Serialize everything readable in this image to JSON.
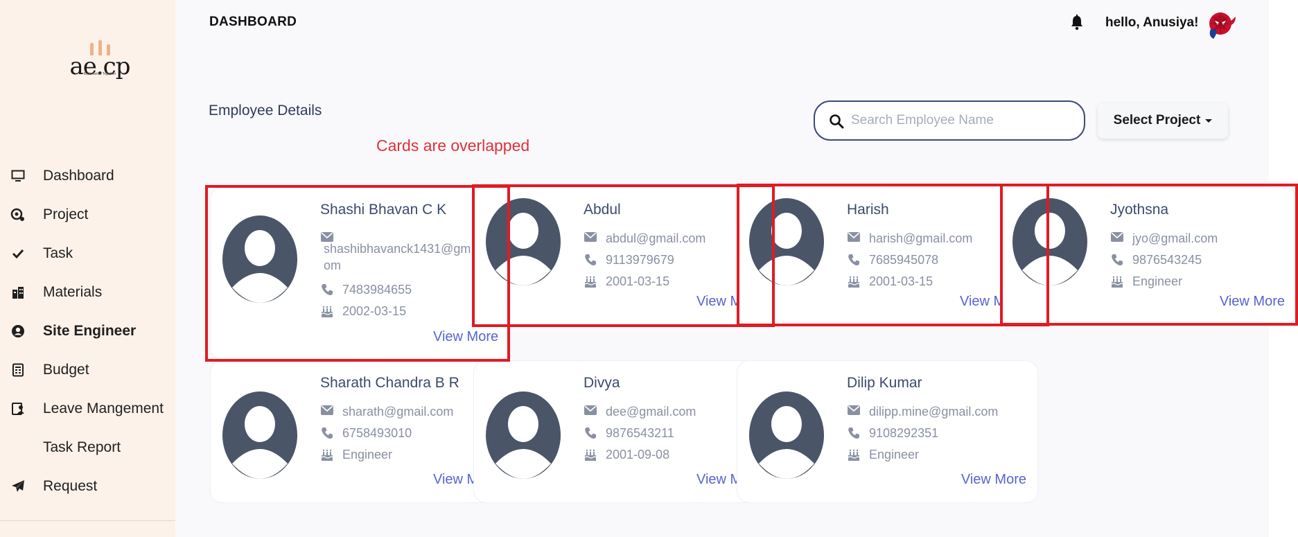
{
  "app": {
    "logo_text": "ae.cp",
    "logo_tagline": "Build Better Together"
  },
  "topbar": {
    "title": "DASHBOARD",
    "greeting": "hello, Anusiya!"
  },
  "sidebar": {
    "items": [
      {
        "label": "Dashboard",
        "icon": "monitor-icon"
      },
      {
        "label": "Project",
        "icon": "project-icon"
      },
      {
        "label": "Task",
        "icon": "check-icon"
      },
      {
        "label": "Materials",
        "icon": "building-icon"
      },
      {
        "label": "Site Engineer",
        "icon": "user-circle-icon",
        "active": true
      },
      {
        "label": "Budget",
        "icon": "budget-icon"
      },
      {
        "label": "Leave Mangement",
        "icon": "leave-icon"
      },
      {
        "label": "Task Report",
        "icon": ""
      },
      {
        "label": "Request",
        "icon": "paper-plane-icon"
      }
    ]
  },
  "main": {
    "section_title": "Employee Details",
    "annotation": "Cards are overlapped",
    "search": {
      "placeholder": "Search Employee Name",
      "value": ""
    },
    "select_project_label": "Select Project",
    "view_more_label": "View More"
  },
  "employees": [
    {
      "name": "Shashi Bhavan C K",
      "email_line1": "shashibhavanck1431@gm",
      "email_line2": "om",
      "phone": "7483984655",
      "detail": "2002-03-15",
      "view_more": "View More"
    },
    {
      "name": "Abdul",
      "email": "abdul@gmail.com",
      "phone": "9113979679",
      "detail": "2001-03-15",
      "view_more": "View M"
    },
    {
      "name": "Harish",
      "email": "harish@gmail.com",
      "phone": "7685945078",
      "detail": "2001-03-15",
      "view_more": "View M"
    },
    {
      "name": "Jyothsna",
      "email": "jyo@gmail.com",
      "phone": "9876543245",
      "detail": "Engineer",
      "view_more": "View More"
    },
    {
      "name": "Sharath Chandra B R",
      "email": "sharath@gmail.com",
      "phone": "6758493010",
      "detail": "Engineer",
      "view_more": "View M"
    },
    {
      "name": "Divya",
      "email": "dee@gmail.com",
      "phone": "9876543211",
      "detail": "2001-09-08",
      "view_more": "View M"
    },
    {
      "name": "Dilip Kumar",
      "email": "dilipp.mine@gmail.com",
      "phone": "9108292351",
      "detail": "Engineer",
      "view_more": "View More"
    }
  ],
  "colors": {
    "accent": "#5664d2",
    "sidebar_bg": "#fcf2ea",
    "highlight_red": "#e01b24",
    "avatar": "#4a5568"
  }
}
